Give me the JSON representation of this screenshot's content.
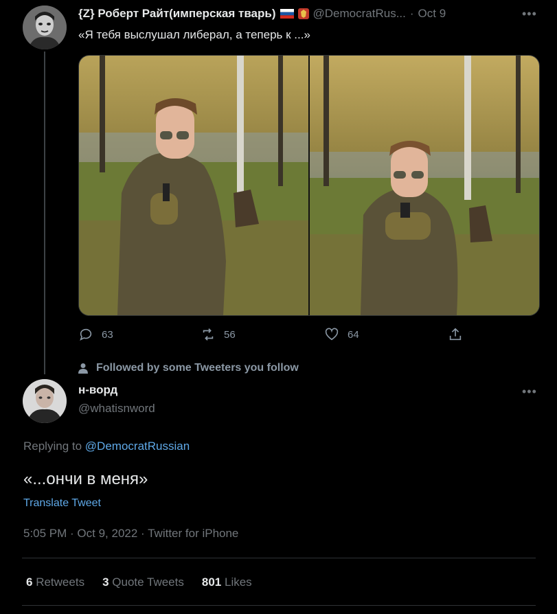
{
  "tweet1": {
    "display_name": "{Z} Роберт Райт(имперская тварь)",
    "flag_icons": [
      "russian-flag-icon",
      "emblem-icon"
    ],
    "handle": "@DemocratRus...",
    "separator": "·",
    "date": "Oct 9",
    "more": "•••",
    "text": "«Я тебя выслушал либерал, а теперь к ...»",
    "actions": {
      "replies": "63",
      "retweets": "56",
      "likes": "64"
    }
  },
  "social_context": {
    "text": "Followed by some Tweeters you follow",
    "icon": "person-icon"
  },
  "tweet2": {
    "display_name": "н-ворд",
    "handle": "@whatisnword",
    "more": "•••",
    "replying_prefix": "Replying to",
    "replying_handle": "@DemocratRussian",
    "text": "«...ончи в меня»",
    "translate": "Translate Tweet",
    "meta": "5:05 PM · Oct 9, 2022 · Twitter for iPhone",
    "stats": {
      "retweets_count": "6",
      "retweets_label": "Retweets",
      "quotes_count": "3",
      "quotes_label": "Quote Tweets",
      "likes_count": "801",
      "likes_label": "Likes"
    }
  },
  "colors": {
    "background": "#000000",
    "text": "#e7e9ea",
    "muted": "#71767b",
    "link": "#5fa9e8",
    "line": "#3d4246"
  }
}
